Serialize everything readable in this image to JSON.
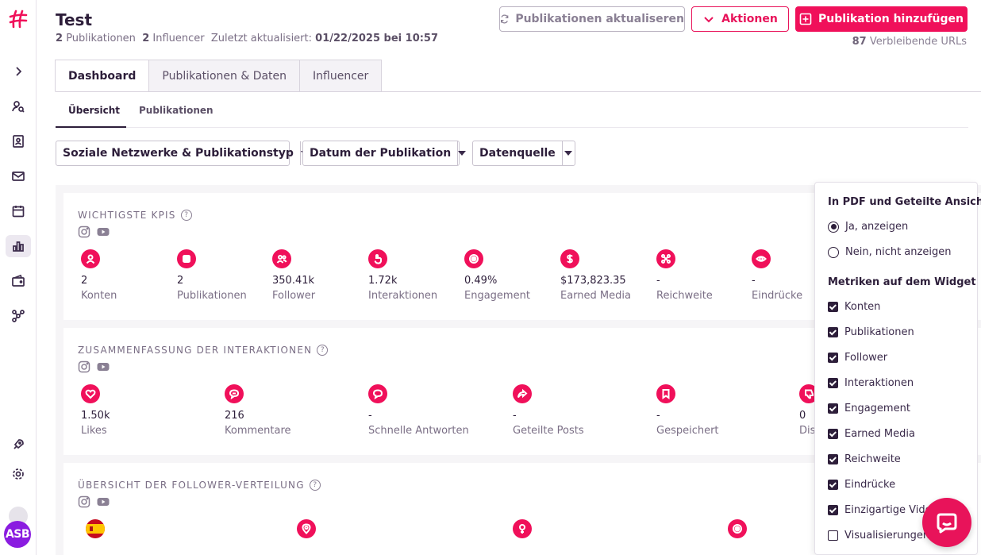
{
  "project": {
    "title": "Test",
    "pub_count": "2",
    "pub_label": "Publikationen",
    "inf_count": "2",
    "inf_label": "Influencer",
    "updated_label": "Zuletzt aktualisiert:",
    "updated_value": "01/22/2025 bei 10:57"
  },
  "actions": {
    "refresh": "Publikationen aktualiseren",
    "actions": "Aktionen",
    "add": "Publikation hinzufügen",
    "remaining_count": "87",
    "remaining_label": "Verbleibende URLs"
  },
  "tabs": [
    "Dashboard",
    "Publikationen & Daten",
    "Influencer"
  ],
  "subtabs": [
    "Übersicht",
    "Publikationen"
  ],
  "filters": [
    "Soziale Netzwerke & Publikationstyp",
    "Datum der Publikation",
    "Datenquelle"
  ],
  "kpis": {
    "title": "WICHTIGSTE KPIS",
    "items": [
      {
        "value": "2",
        "label": "Konten",
        "icon": "user-icon"
      },
      {
        "value": "2",
        "label": "Publikationen",
        "icon": "publication-icon"
      },
      {
        "value": "350.41k",
        "label": "Follower",
        "icon": "followers-icon"
      },
      {
        "value": "1.72k",
        "label": "Interaktionen",
        "icon": "hand-pointer-icon"
      },
      {
        "value": "0.49%",
        "label": "Engagement",
        "icon": "target-icon"
      },
      {
        "value": "$173,823.35",
        "label": "Earned Media",
        "icon": "dollar-icon"
      },
      {
        "value": "-",
        "label": "Reichweite",
        "icon": "network-icon"
      },
      {
        "value": "-",
        "label": "Eindrücke",
        "icon": "eye-icon"
      }
    ]
  },
  "interactions": {
    "title": "ZUSAMMENFASSUNG DER INTERAKTIONEN",
    "items": [
      {
        "value": "1.50k",
        "label": "Likes",
        "icon": "heart-icon"
      },
      {
        "value": "216",
        "label": "Kommentare",
        "icon": "comment-icon"
      },
      {
        "value": "-",
        "label": "Schnelle Antworten",
        "icon": "quick-reply-icon"
      },
      {
        "value": "-",
        "label": "Geteilte Posts",
        "icon": "share-icon"
      },
      {
        "value": "-",
        "label": "Gespeichert",
        "icon": "bookmark-icon"
      },
      {
        "value": "0",
        "label": "Dis",
        "icon": "dislike-icon"
      }
    ]
  },
  "followers": {
    "title": "ÜBERSICHT DER FOLLOWER-VERTEILUNG"
  },
  "panel": {
    "pdf_title": "In PDF und Geteilte Ansicht",
    "yes": "Ja, anzeigen",
    "no": "Nein, nicht anzeigen",
    "metrics_title": "Metriken auf dem Widget",
    "metrics": [
      {
        "label": "Konten",
        "checked": true
      },
      {
        "label": "Publikationen",
        "checked": true
      },
      {
        "label": "Follower",
        "checked": true
      },
      {
        "label": "Interaktionen",
        "checked": true
      },
      {
        "label": "Engagement",
        "checked": true
      },
      {
        "label": "Earned Media",
        "checked": true
      },
      {
        "label": "Reichweite",
        "checked": true
      },
      {
        "label": "Eindrücke",
        "checked": true
      },
      {
        "label": "Einzigartige Video",
        "checked": true
      },
      {
        "label": "Visualisierungen",
        "checked": false
      }
    ]
  },
  "user": {
    "initials": "ASB"
  },
  "colors": {
    "accent": "#f0105a",
    "text": "#2d1e3a"
  }
}
